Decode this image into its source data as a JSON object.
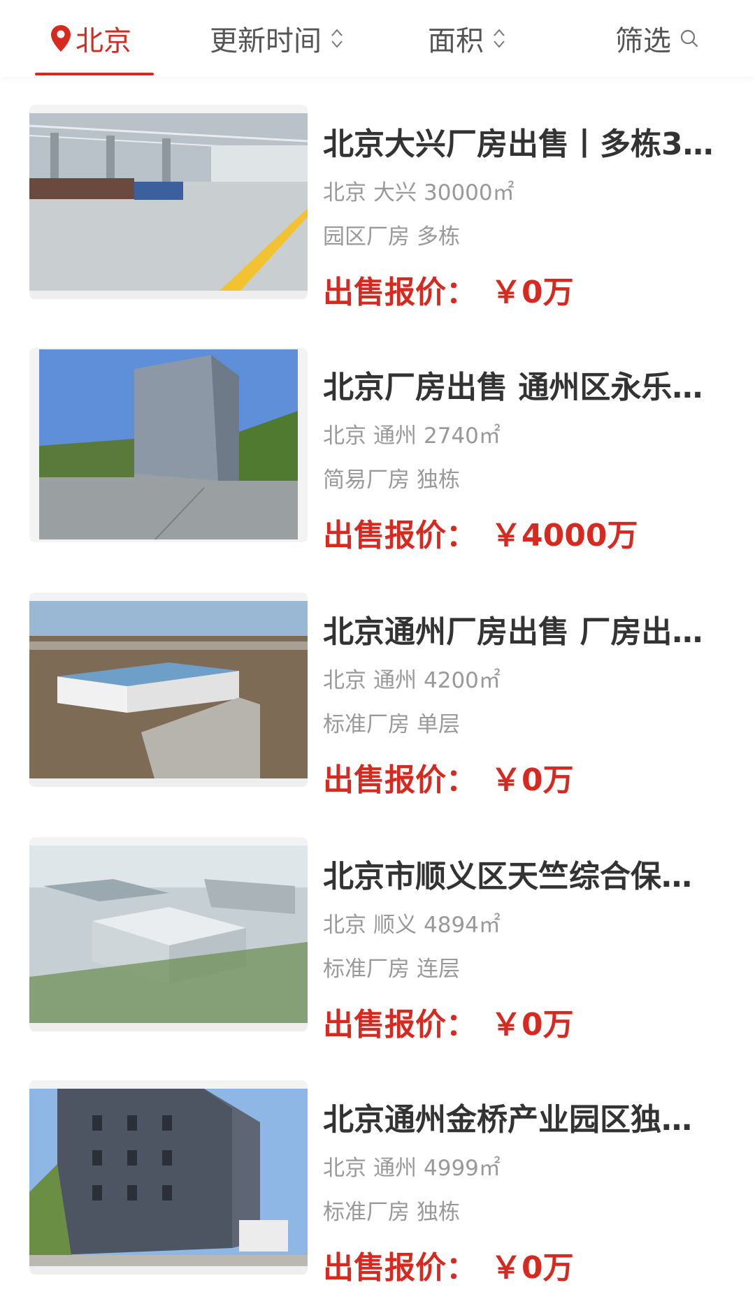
{
  "tabs": {
    "location": {
      "label": "北京",
      "icon": "location-pin-icon"
    },
    "update_time": {
      "label": "更新时间",
      "icon": "sort-toggle-icon"
    },
    "area": {
      "label": "面积",
      "icon": "sort-toggle-icon"
    },
    "filter": {
      "label": "筛选",
      "icon": "search-icon"
    }
  },
  "colors": {
    "accent": "#d7291f",
    "title": "#333333",
    "meta": "#999999"
  },
  "listings": [
    {
      "title": "北京大兴厂房出售丨多栋3…",
      "city": "北京",
      "district": "大兴",
      "area": "30000㎡",
      "category": "园区厂房",
      "building": "多栋",
      "price_label": "出售报价：",
      "price": "￥0万"
    },
    {
      "title": "北京厂房出售 通州区永乐…",
      "city": "北京",
      "district": "通州",
      "area": "2740㎡",
      "category": "简易厂房",
      "building": "独栋",
      "price_label": "出售报价：",
      "price": "￥4000万"
    },
    {
      "title": "北京通州厂房出售 厂房出…",
      "city": "北京",
      "district": "通州",
      "area": "4200㎡",
      "category": "标准厂房",
      "building": "单层",
      "price_label": "出售报价：",
      "price": "￥0万"
    },
    {
      "title": "北京市顺义区天竺综合保…",
      "city": "北京",
      "district": "顺义",
      "area": "4894㎡",
      "category": "标准厂房",
      "building": "连层",
      "price_label": "出售报价：",
      "price": "￥0万"
    },
    {
      "title": "北京通州金桥产业园区独…",
      "city": "北京",
      "district": "通州",
      "area": "4999㎡",
      "category": "标准厂房",
      "building": "独栋",
      "price_label": "出售报价：",
      "price": "￥0万"
    }
  ]
}
